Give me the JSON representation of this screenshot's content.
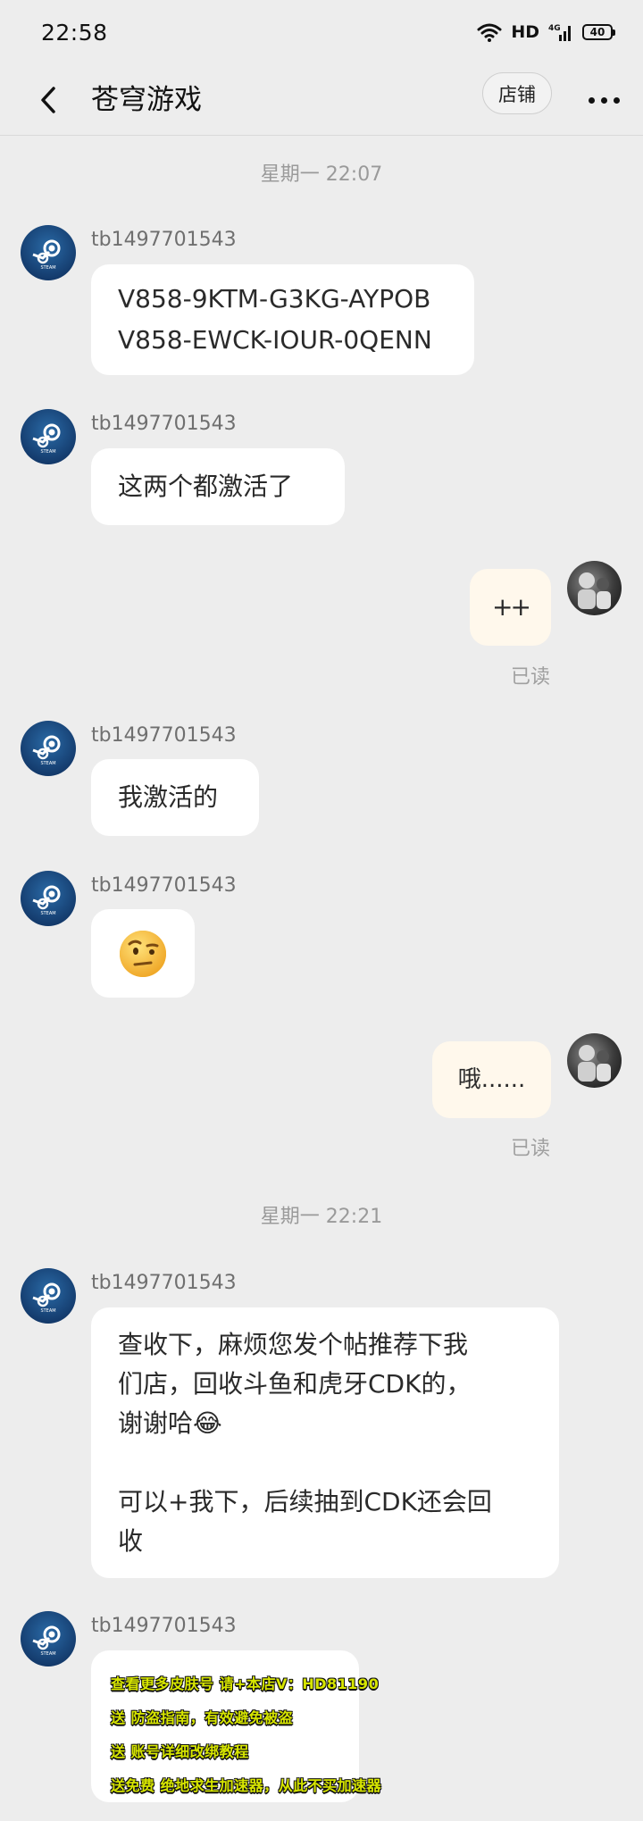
{
  "status_bar": {
    "time": "22:58",
    "network": "HD",
    "signal": "4G",
    "battery": "40"
  },
  "nav": {
    "title": "苍穹游戏",
    "shop_label": "店铺"
  },
  "messages": [
    {
      "timestamp": "星期一 22:07"
    },
    {
      "sender": "tb1497701543",
      "text": "V858-9KTM-G3KG-AYPOB\nV858-EWCK-IOUR-0QENN"
    },
    {
      "sender": "tb1497701543",
      "text": "这两个都激活了"
    },
    {
      "mine": true,
      "text": "++",
      "read": "已读"
    },
    {
      "sender": "tb1497701543",
      "text": "我激活的"
    },
    {
      "sender": "tb1497701543",
      "emoji": "🤨"
    },
    {
      "mine": true,
      "text": "哦......",
      "read": "已读"
    },
    {
      "timestamp": "星期一 22:21"
    },
    {
      "sender": "tb1497701543",
      "text": "查收下，麻烦您发个帖推荐下我\n们店，回收斗鱼和虎牙CDK的，\n谢谢哈😂\n\n可以+我下，后续抽到CDK还会回\n收"
    },
    {
      "sender": "tb1497701543",
      "image_lines": [
        "查看更多皮肤号 请+本店V：HD81190",
        "送 防盗指南，有效避免被盗",
        "送 账号详细改绑教程",
        "送免费 绝地求生加速器，从此不买加速器"
      ]
    }
  ],
  "colors": {
    "background": "#ededed",
    "bubble_incoming": "#ffffff",
    "bubble_outgoing": "#fff8ec",
    "steam_blue": "#1b4a80"
  },
  "icons": [
    "back-arrow-icon",
    "more-dots-icon",
    "wifi-icon",
    "signal-icon",
    "battery-icon",
    "steam-logo-icon",
    "user-avatar"
  ]
}
